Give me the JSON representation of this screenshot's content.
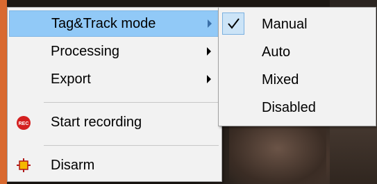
{
  "context_menu": {
    "items": [
      {
        "label": "Tag&Track mode",
        "has_submenu": true,
        "highlighted": true
      },
      {
        "label": "Processing",
        "has_submenu": true
      },
      {
        "label": "Export",
        "has_submenu": true
      },
      {
        "label": "Start recording",
        "icon": "record-icon"
      },
      {
        "label": "Disarm",
        "icon": "disarm-icon"
      }
    ],
    "record_icon_text": "REC"
  },
  "submenu": {
    "items": [
      {
        "label": "Manual",
        "checked": true
      },
      {
        "label": "Auto",
        "checked": false
      },
      {
        "label": "Mixed",
        "checked": false
      },
      {
        "label": "Disabled",
        "checked": false
      }
    ]
  },
  "colors": {
    "highlight": "#91c9f7",
    "record_icon": "#d42020",
    "disarm_icon_fill": "#f5b800",
    "disarm_icon_stroke": "#b01818"
  }
}
